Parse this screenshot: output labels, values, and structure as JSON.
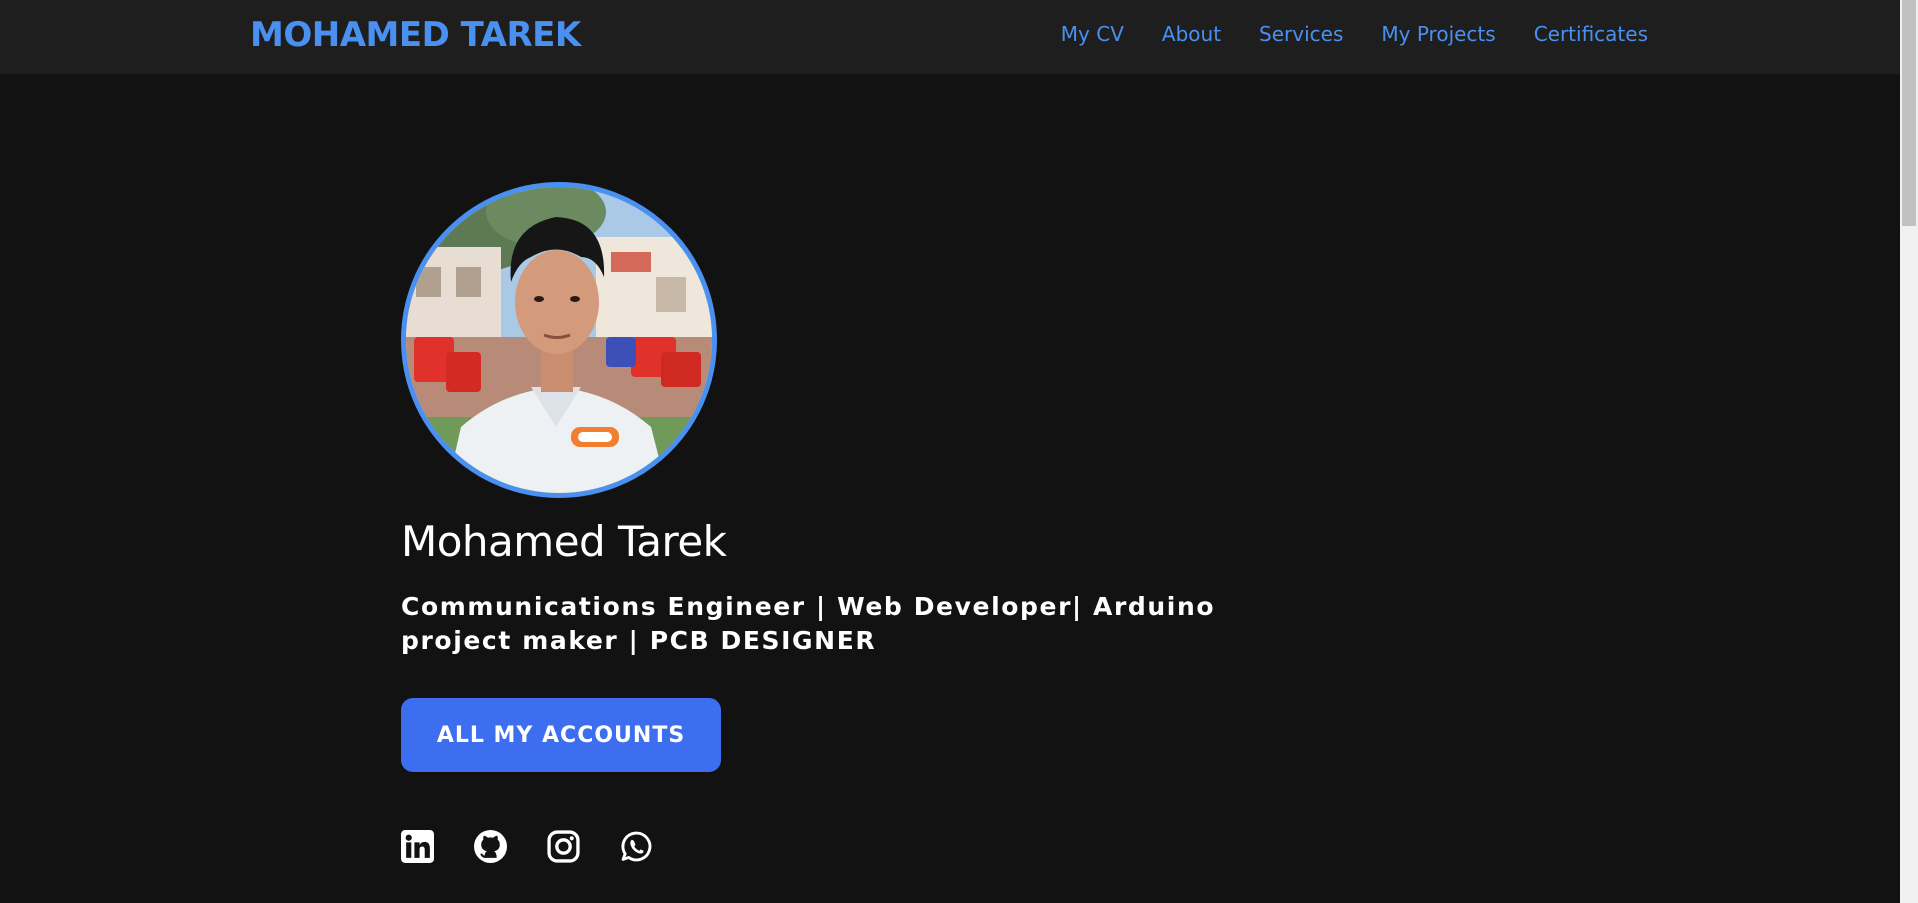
{
  "header": {
    "brand": "MOHAMED TAREK",
    "nav": [
      {
        "label": "My CV"
      },
      {
        "label": "About"
      },
      {
        "label": "Services"
      },
      {
        "label": "My Projects"
      },
      {
        "label": "Certificates"
      }
    ]
  },
  "hero": {
    "name": "Mohamed Tarek",
    "tagline": "Communications Engineer | Web Developer| Arduino project maker | PCB DESIGNER",
    "cta_label": "ALL MY ACCOUNTS"
  },
  "socials": [
    {
      "icon": "linkedin-icon"
    },
    {
      "icon": "github-icon"
    },
    {
      "icon": "instagram-icon"
    },
    {
      "icon": "whatsapp-icon"
    }
  ],
  "colors": {
    "background": "#121212",
    "navbar": "#1e1e1e",
    "accent": "#4a90f0",
    "button": "#3d6ef0",
    "text": "#ffffff"
  }
}
